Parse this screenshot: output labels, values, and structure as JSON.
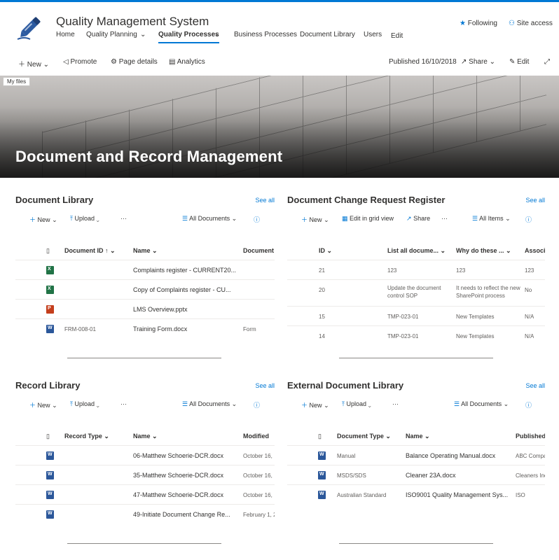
{
  "header": {
    "site_title": "Quality Management System",
    "nav": [
      "Home",
      "Quality Planning",
      "Quality Processes",
      "Business Processes",
      "Document Library",
      "Users",
      "Edit"
    ],
    "following": "Following",
    "site_access": "Site access"
  },
  "command_bar": {
    "new": "New",
    "promote": "Promote",
    "page_details": "Page details",
    "analytics": "Analytics",
    "published": "Published 16/10/2018",
    "share": "Share",
    "edit": "Edit"
  },
  "hero": {
    "title": "Document and Record Management",
    "tooltip": "My files"
  },
  "doc_library": {
    "title": "Document Library",
    "see_all": "See all",
    "toolbar": {
      "new": "New",
      "upload": "Upload",
      "more": "···",
      "view": "All Documents"
    },
    "headers": [
      "Document ID",
      "Name",
      "Document"
    ],
    "rows": [
      {
        "type": "xlsx",
        "id": "",
        "name": "Complaints register - CURRENT20...",
        "extra": ""
      },
      {
        "type": "xlsx",
        "id": "",
        "name": "Copy of Complaints register - CU...",
        "extra": ""
      },
      {
        "type": "pptx",
        "id": "",
        "name": "LMS Overview.pptx",
        "extra": ""
      },
      {
        "type": "docx",
        "id": "FRM-008-01",
        "name": "Training Form.docx",
        "extra": "Form"
      }
    ]
  },
  "change_register": {
    "title": "Document Change Request Register",
    "see_all": "See all",
    "toolbar": {
      "new": "New",
      "edit_grid": "Edit in grid view",
      "share": "Share",
      "more": "···",
      "view": "All Items"
    },
    "headers": [
      "ID",
      "List all docume...",
      "Why do these ...",
      "Associa"
    ],
    "rows": [
      {
        "id": "21",
        "docs": "123",
        "why": "123",
        "assoc": "123"
      },
      {
        "id": "20",
        "docs": "Update the document control SOP",
        "why": "It needs to reflect the new SharePoint process",
        "assoc": "No"
      },
      {
        "id": "15",
        "docs": "TMP-023-01",
        "why": "New Templates",
        "assoc": "N/A"
      },
      {
        "id": "14",
        "docs": "TMP-023-01",
        "why": "New Templates",
        "assoc": "N/A"
      }
    ]
  },
  "record_library": {
    "title": "Record Library",
    "see_all": "See all",
    "toolbar": {
      "new": "New",
      "upload": "Upload",
      "more": "···",
      "view": "All Documents"
    },
    "headers": [
      "Record Type",
      "Name",
      "Modified"
    ],
    "rows": [
      {
        "type": "docx",
        "rtype": "",
        "name": "06-Matthew Schoerie-DCR.docx",
        "modified": "October 16,"
      },
      {
        "type": "docx",
        "rtype": "",
        "name": "35-Matthew Schoerie-DCR.docx",
        "modified": "October 16,"
      },
      {
        "type": "docx",
        "rtype": "",
        "name": "47-Matthew Schoerie-DCR.docx",
        "modified": "October 16,"
      },
      {
        "type": "docx",
        "rtype": "",
        "name": "49-Initiate Document Change Re...",
        "modified": "February 1, 2"
      }
    ]
  },
  "external_library": {
    "title": "External Document Library",
    "see_all": "See all",
    "toolbar": {
      "new": "New",
      "upload": "Upload",
      "more": "···",
      "view": "All Documents"
    },
    "headers": [
      "Document Type",
      "Name",
      "Published"
    ],
    "rows": [
      {
        "type": "docx",
        "dtype": "Manual",
        "name": "Balance Operating Manual.docx",
        "pub": "ABC Compa"
      },
      {
        "type": "docx",
        "dtype": "MSDS/SDS",
        "name": "Cleaner 23A.docx",
        "pub": "Cleaners Inc"
      },
      {
        "type": "docx",
        "dtype": "Australian Standard",
        "name": "ISO9001 Quality Management Sys...",
        "pub": "ISO"
      }
    ]
  },
  "colors": {
    "accent": "#0078d4",
    "excel": "#217346",
    "powerpoint": "#c43e1c",
    "word": "#2b579a"
  }
}
